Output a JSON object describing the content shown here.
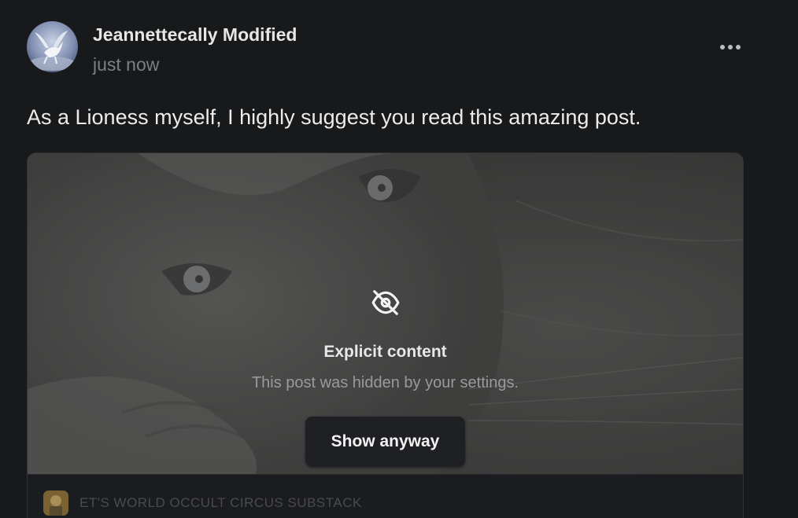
{
  "author": {
    "name": "Jeannettecally Modified",
    "timestamp": "just now",
    "avatar_icon": "pegasus-avatar"
  },
  "post": {
    "text": "As a Lioness myself, I highly suggest you read this amazing post."
  },
  "media": {
    "icon": "eye-off-icon",
    "title": "Explicit content",
    "subtitle": "This post was hidden by your settings.",
    "button_label": "Show anyway"
  },
  "publication": {
    "name": "ET'S WORLD OCCULT CIRCUS SUBSTACK"
  },
  "colors": {
    "background": "#18191b",
    "text_primary": "#ececec",
    "text_muted": "#7d7f82"
  }
}
